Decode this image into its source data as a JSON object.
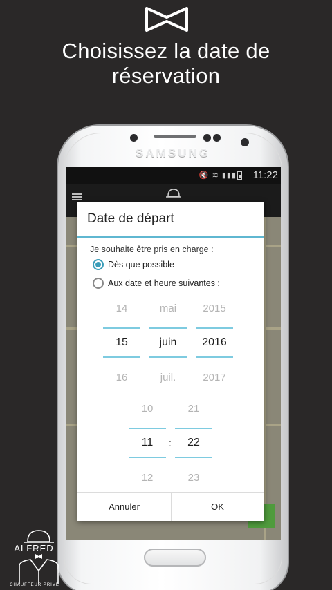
{
  "promo": {
    "title_line1": "Choisissez la date de",
    "title_line2": "réservation",
    "icon": "bowtie-icon"
  },
  "phone": {
    "brand": "SAMSUNG"
  },
  "status_bar": {
    "icons": "mute, wifi, signal",
    "battery": "47%",
    "time": "11:22"
  },
  "dialog": {
    "title": "Date de départ",
    "prompt": "Je souhaite être pris en charge :",
    "options": [
      {
        "label": "Dès que possible",
        "checked": true
      },
      {
        "label": "Aux date et heure suivantes :",
        "checked": false
      }
    ],
    "date_picker": {
      "day": {
        "prev": "14",
        "current": "15",
        "next": "16"
      },
      "month": {
        "prev": "mai",
        "current": "juin",
        "next": "juil."
      },
      "year": {
        "prev": "2015",
        "current": "2016",
        "next": "2017"
      }
    },
    "time_picker": {
      "hour": {
        "prev": "10",
        "current": "11",
        "next": "12"
      },
      "separator": ":",
      "minute": {
        "prev": "21",
        "current": "22",
        "next": "23"
      }
    },
    "cancel_label": "Annuler",
    "ok_label": "OK"
  },
  "branding": {
    "name": "ALFRED",
    "tagline": "CHAUFFEUR PRIVE"
  },
  "colors": {
    "background": "#2a2828",
    "accent": "#5fb7d1",
    "radio_checked": "#3a9db9"
  }
}
